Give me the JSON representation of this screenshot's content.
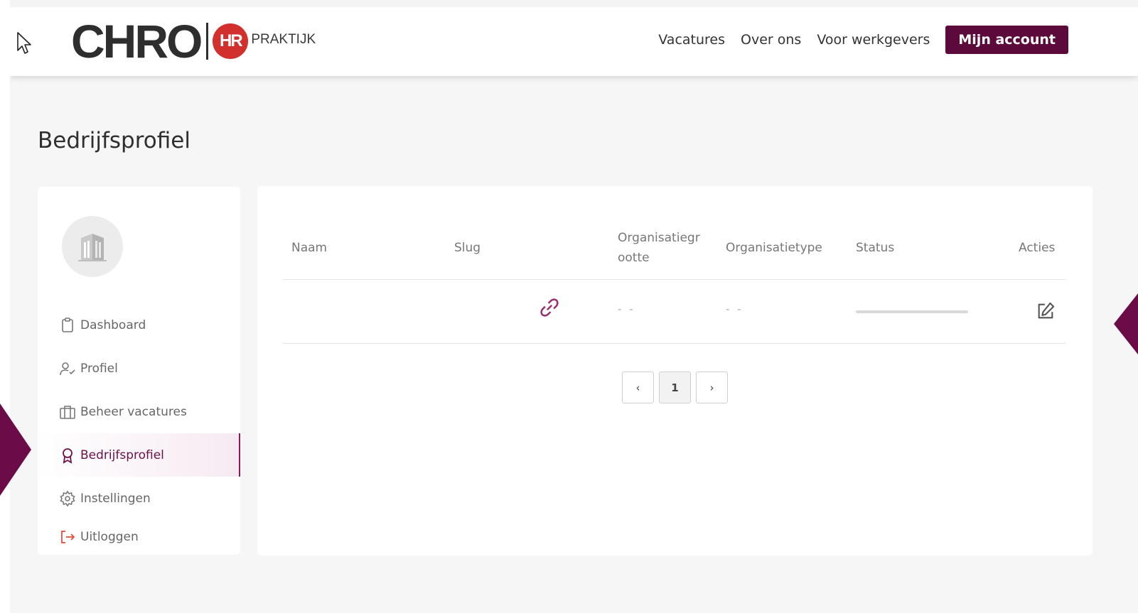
{
  "header": {
    "logo": {
      "main": "CHRO",
      "badge": "HR",
      "suffix": "PRAKTIJK"
    },
    "nav": [
      {
        "label": "Vacatures"
      },
      {
        "label": "Over ons"
      },
      {
        "label": "Voor werkgevers"
      }
    ],
    "account_label": "Mijn account"
  },
  "page": {
    "title": "Bedrijfsprofiel"
  },
  "sidebar": {
    "items": [
      {
        "label": "Dashboard",
        "icon": "clipboard-icon"
      },
      {
        "label": "Profiel",
        "icon": "user-check-icon"
      },
      {
        "label": "Beheer vacatures",
        "icon": "briefcase-icon"
      },
      {
        "label": "Bedrijfsprofiel",
        "icon": "award-icon",
        "active": true
      },
      {
        "label": "Instellingen",
        "icon": "gear-icon"
      },
      {
        "label": "Uitloggen",
        "icon": "logout-icon"
      }
    ]
  },
  "table": {
    "headers": {
      "naam": "Naam",
      "slug": "Slug",
      "grootte_1": "Organisatiegr",
      "grootte_2": "ootte",
      "type": "Organisatietype",
      "status": "Status",
      "acties": "Acties"
    },
    "row": {
      "grootte": "- -",
      "type": "- -"
    }
  },
  "pagination": {
    "prev": "‹",
    "current": "1",
    "next": "›"
  },
  "colors": {
    "brand": "#5c0a3c",
    "accent": "#8a1a5c",
    "logo_red": "#d2302c"
  }
}
